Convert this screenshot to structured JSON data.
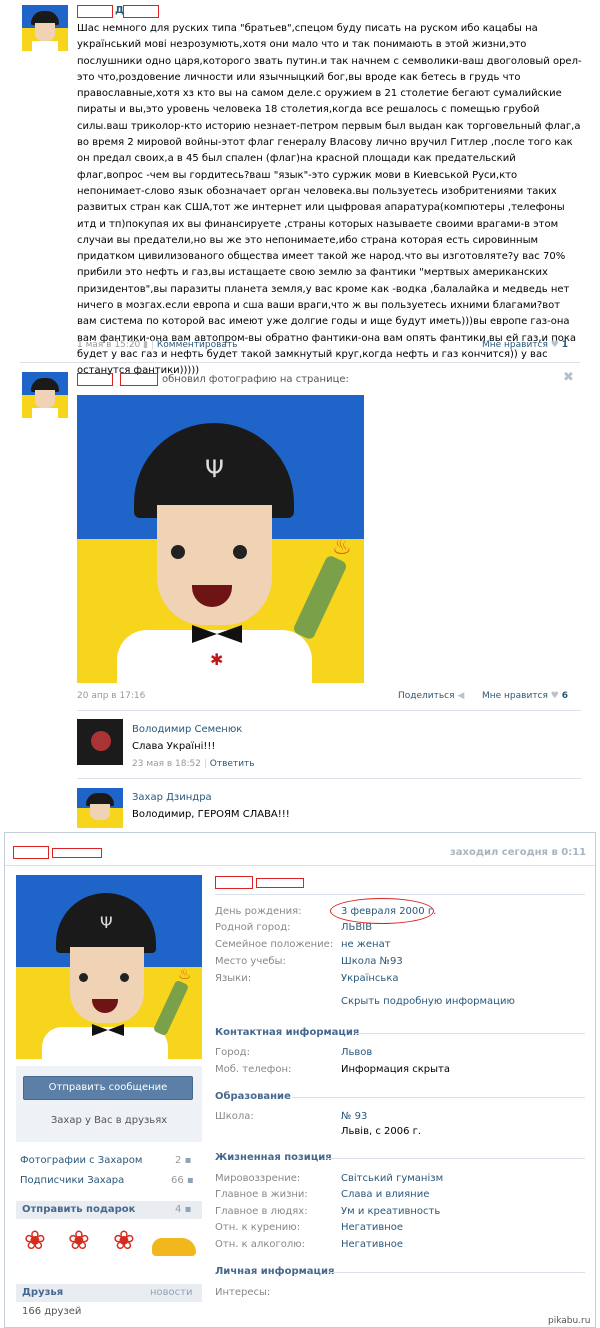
{
  "post1": {
    "author_name": "",
    "text": "Шас немного для руских типа \"братьев\",спецом буду писать на руском ибо кацабы на український мові незрозумють,хотя они мало что и так понимають в этой жизни,это послушники одно царя,которого звать путин.и так начнем с семволики-ваш двоголовый орел-это что,роздовение личности или язычныцкий бог,вы вроде как бетесь в грудь что православные,хотя хз кто вы на самом деле.с оружием в 21 столетие бегают сумалийские пираты и вы,это уровень человека 18 столетия,когда все решалось с помещью грубой силы.ваш триколор-кто историю незнает-петром первым был выдан как торговельный флаг,а во время 2 мировой войны-этот флаг генералу Власову лично вручил Гитлер ,после того как он предал своих,а в 45 был спален (флаг)на красной площади как предательский флаг,вопрос -чем вы гордитесь?ваш \"язык\"-это суржик мови в Киевськой Руси,кто непонимает-слово язык обозначает орган человека.вы пользуетесь изобритениями таких развитых стран как США,тот же интернет или цыфровая апаратура(компютеры ,телефоны итд и тп)покупая их вы финансируете ,страны которых называете своими врагами-в этом случаи вы предатели,но вы же это непонимаете,ибо страна которая есть сировинным придатком цивилизованого общества имеет такой же народ.что вы изготовляте?у вас 70% прибили это нефть и газ,вы истащаете свою землю за фантики \"мертвых американских призидентов\",вы паразиты планета земля,у вас кроме как -водка ,балалайка и медведь нет ничего в мозгах.если европа и сша ваши враги,что ж вы пользуетесь ихними благами?вот вам система по которой вас имеют уже долгие годы и ище будут иметь)))вы европе газ-она вам фантики-она вам автопром-вы обратно фантики-она вам опять фантики вы ей газ,и пока будет у вас газ и нефть будет такой замкнутый круг,когда нефть и газ кончится)) у вас останутся фантики)))))",
    "date": "1 мая в 15:20",
    "comment_link": "Комментировать",
    "like_label": "Мне нравится",
    "like_count": "1"
  },
  "post2": {
    "action_text": "обновил фотографию на странице:",
    "date": "20 апр в 17:16",
    "share_label": "Поделиться",
    "like_label": "Мне нравится",
    "like_count": "6",
    "comments": [
      {
        "author": "Володимир Семенюк",
        "text": "Слава Україні!!!",
        "date": "23 мая в 18:52",
        "reply": "Ответить"
      },
      {
        "author": "Захар Дзиндра",
        "text": "Володимир, ГЕРОЯМ СЛАВА!!!",
        "date": "",
        "reply": ""
      }
    ]
  },
  "profile": {
    "status": "заходил сегодня в 0:11",
    "send_message": "Отправить сообщение",
    "friend_status": "Захар у Вас в друзьях",
    "left_links": [
      {
        "label": "Фотографии с Захаром",
        "count": "2"
      },
      {
        "label": "Подписчики Захара",
        "count": "66"
      }
    ],
    "gifts_header": "Отправить подарок",
    "gifts_count": "4",
    "friends_header": "Друзья",
    "friends_news": "новости",
    "friends_count": "166 друзей",
    "basic_fields": [
      {
        "label": "День рождения:",
        "value": "3 февраля 2000 г."
      },
      {
        "label": "Родной город:",
        "value": "ЛЬВІВ"
      },
      {
        "label": "Семейное положение:",
        "value": "не женат"
      },
      {
        "label": "Место учебы:",
        "value": "Школа №93"
      },
      {
        "label": "Языки:",
        "value": "Українська"
      }
    ],
    "more_info": "Скрыть подробную информацию",
    "contact_header": "Контактная информация",
    "contact_fields": [
      {
        "label": "Город:",
        "value": "Львов"
      },
      {
        "label": "Моб. телефон:",
        "value": "Информация скрыта"
      }
    ],
    "edu_header": "Образование",
    "school_label": "Школа:",
    "school_value": "№ 93",
    "school_detail": "Львів, с 2006 г.",
    "life_header": "Жизненная позиция",
    "life_fields": [
      {
        "label": "Мировоззрение:",
        "value": "Світський гуманізм"
      },
      {
        "label": "Главное в жизни:",
        "value": "Слава и влияние"
      },
      {
        "label": "Главное в людях:",
        "value": "Ум и креативность"
      },
      {
        "label": "Отн. к курению:",
        "value": "Негативное"
      },
      {
        "label": "Отн. к алкоголю:",
        "value": "Негативное"
      }
    ],
    "personal_header": "Личная информация",
    "interests_label": "Интересы:"
  },
  "watermark": "pikabu.ru",
  "colors": {
    "link": "#2b587a",
    "flag_blue": "#1f64c9",
    "flag_yellow": "#f7d51d",
    "button": "#5b7fa6"
  }
}
